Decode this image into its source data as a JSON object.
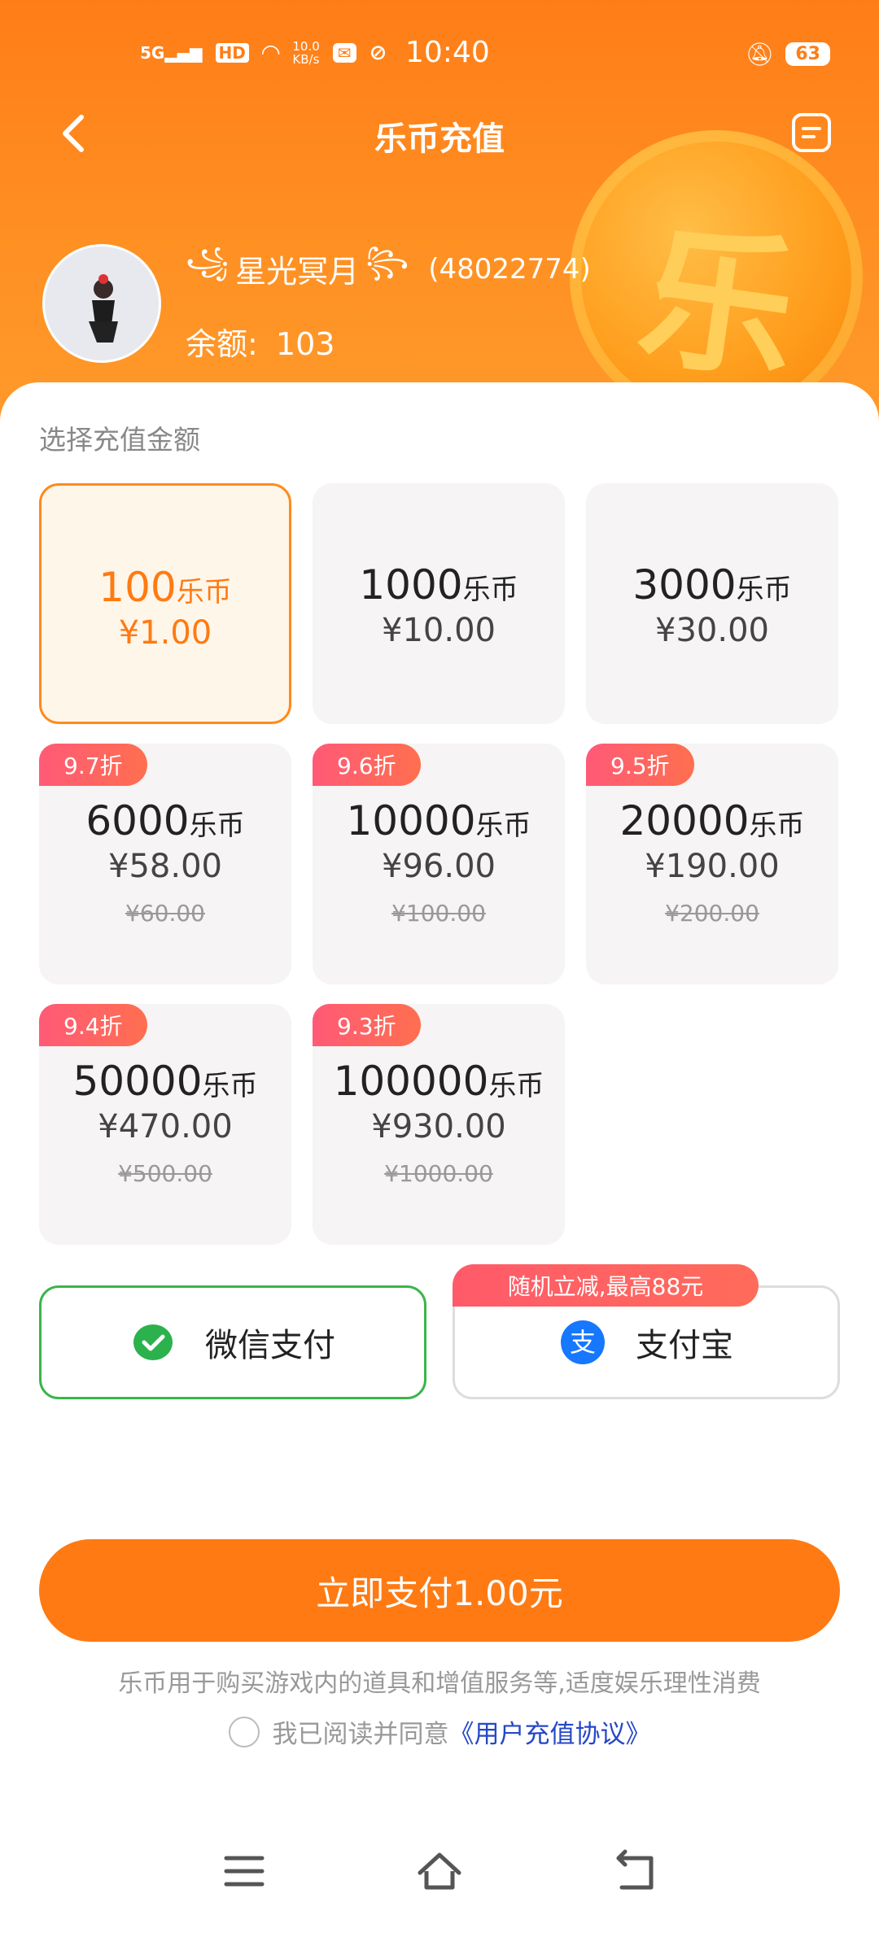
{
  "status_bar": {
    "network": "5G",
    "hd": "HD",
    "speed_value": "10.0",
    "speed_unit": "KB/s",
    "time": "10:40",
    "battery": "63"
  },
  "nav": {
    "title": "乐币充值"
  },
  "coin_glyph": "乐",
  "user": {
    "name": "星光冥月",
    "uid": "(48022774)",
    "balance_label": "余额:",
    "balance_value": "103"
  },
  "section_label": "选择充值金额",
  "unit": "乐币",
  "options": [
    {
      "coins": "100",
      "price": "¥1.00",
      "selected": true
    },
    {
      "coins": "1000",
      "price": "¥10.00"
    },
    {
      "coins": "3000",
      "price": "¥30.00"
    },
    {
      "coins": "6000",
      "price": "¥58.00",
      "discount": "9.7折",
      "original": "¥60.00"
    },
    {
      "coins": "10000",
      "price": "¥96.00",
      "discount": "9.6折",
      "original": "¥100.00"
    },
    {
      "coins": "20000",
      "price": "¥190.00",
      "discount": "9.5折",
      "original": "¥200.00"
    },
    {
      "coins": "50000",
      "price": "¥470.00",
      "discount": "9.4折",
      "original": "¥500.00"
    },
    {
      "coins": "100000",
      "price": "¥930.00",
      "discount": "9.3折",
      "original": "¥1000.00"
    }
  ],
  "payment": {
    "wechat_label": "微信支付",
    "alipay_label": "支付宝",
    "alipay_promo": "随机立减,最高88元",
    "selected": "wechat"
  },
  "pay_button": "立即支付1.00元",
  "notice": "乐币用于购买游戏内的道具和增值服务等,适度娱乐理性消费",
  "agreement": {
    "prefix": "我已阅读并同意",
    "link": "《用户充值协议》",
    "checked": false
  },
  "colors": {
    "accent": "#ff7a12",
    "wechat": "#3bb54a",
    "alipay": "#1677ff",
    "badge": "#ff5a77",
    "link": "#2547c7"
  }
}
